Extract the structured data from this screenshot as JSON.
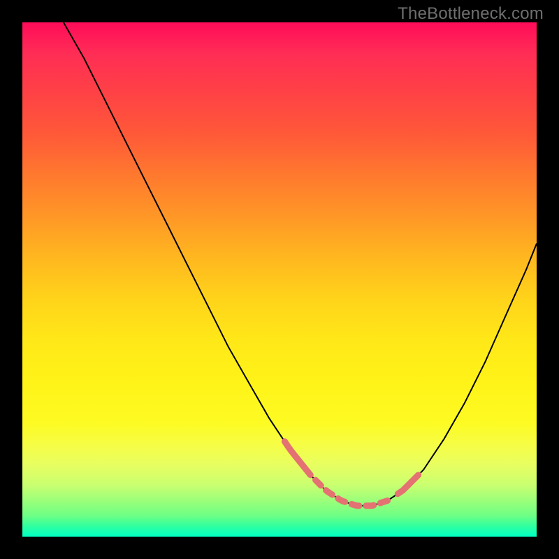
{
  "watermark": "TheBottleneck.com",
  "colors": {
    "background": "#000000",
    "curve": "#000000",
    "highlight": "#e47272"
  },
  "chart_data": {
    "type": "line",
    "title": "",
    "xlabel": "",
    "ylabel": "",
    "xlim": [
      0,
      100
    ],
    "ylim": [
      0,
      100
    ],
    "series": [
      {
        "name": "curve",
        "x": [
          8,
          12,
          16,
          20,
          24,
          28,
          32,
          36,
          40,
          44,
          48,
          52,
          56,
          59,
          62,
          65,
          68,
          71,
          74,
          78,
          82,
          86,
          90,
          94,
          98,
          100
        ],
        "y": [
          100,
          93,
          85,
          77,
          69,
          61,
          53,
          45,
          37,
          30,
          23,
          17,
          12,
          9,
          7,
          6,
          6,
          7,
          9,
          13,
          19,
          26,
          34,
          43,
          52,
          57
        ]
      }
    ],
    "highlight_ranges_x": [
      [
        51,
        56
      ],
      [
        57,
        71
      ],
      [
        73,
        77
      ]
    ],
    "gradient_stops": [
      {
        "pos": 0.0,
        "color": "#ff0b59"
      },
      {
        "pos": 0.5,
        "color": "#ffd41a"
      },
      {
        "pos": 0.8,
        "color": "#fdfb23"
      },
      {
        "pos": 1.0,
        "color": "#00ffc4"
      }
    ]
  }
}
